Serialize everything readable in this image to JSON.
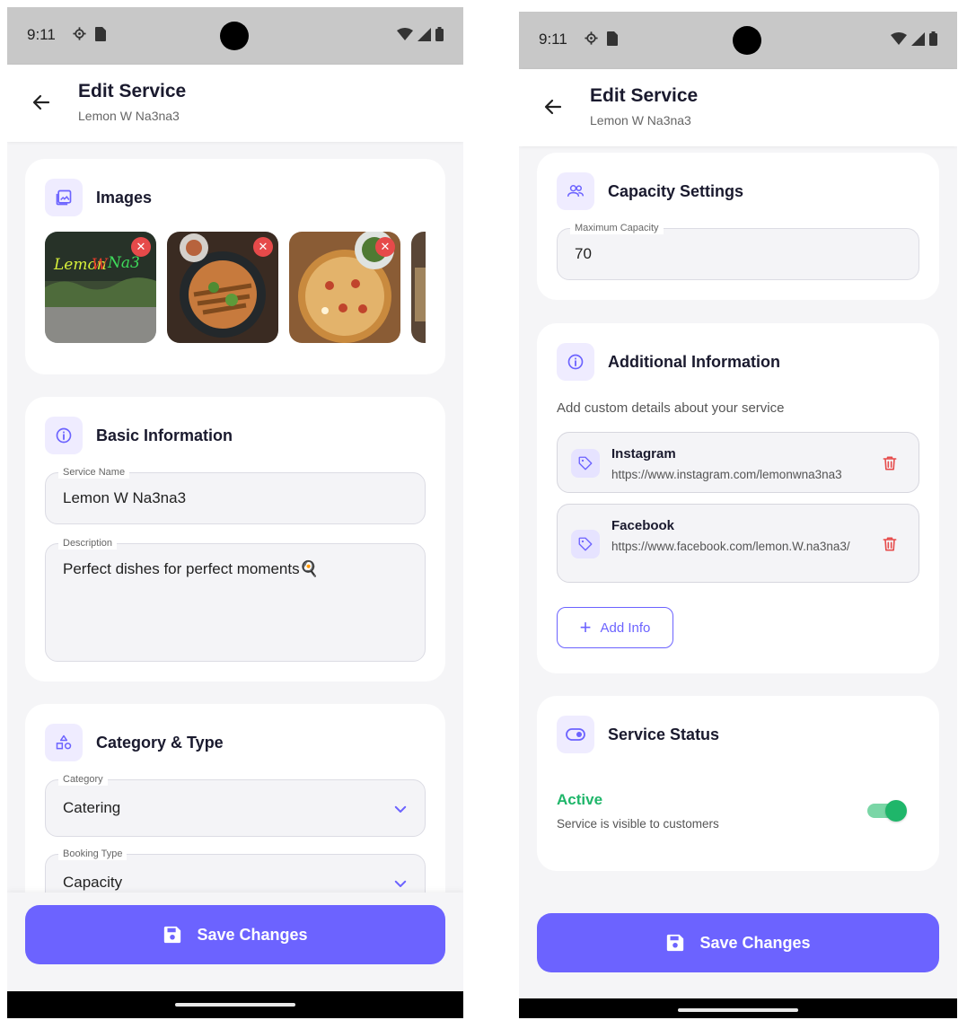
{
  "status_bar": {
    "time": "9:11"
  },
  "app_bar": {
    "title": "Edit Service",
    "subtitle": "Lemon W Na3na3"
  },
  "images_card": {
    "title": "Images"
  },
  "basic_info": {
    "title": "Basic Information",
    "service_name_label": "Service Name",
    "service_name_value": "Lemon W Na3na3",
    "description_label": "Description",
    "description_value": "Perfect dishes for perfect moments🍳"
  },
  "category_type": {
    "title": "Category & Type",
    "category_label": "Category",
    "category_value": "Catering",
    "booking_type_label": "Booking Type",
    "booking_type_value": "Capacity"
  },
  "capacity": {
    "title": "Capacity Settings",
    "max_label": "Maximum Capacity",
    "max_value": "70"
  },
  "additional_info": {
    "title": "Additional Information",
    "hint": "Add custom details about your service",
    "items": [
      {
        "title": "Instagram",
        "value": "https://www.instagram.com/lemonwna3na3"
      },
      {
        "title": "Facebook",
        "value": "https://www.facebook.com/lemon.W.na3na3/"
      }
    ],
    "add_label": "Add Info"
  },
  "service_status": {
    "title": "Service Status",
    "state": "Active",
    "state_desc": "Service is visible to customers",
    "enabled": true
  },
  "save_label": "Save Changes",
  "colors": {
    "accent": "#6c63ff",
    "active": "#1fb66a",
    "danger": "#e64a4a"
  }
}
